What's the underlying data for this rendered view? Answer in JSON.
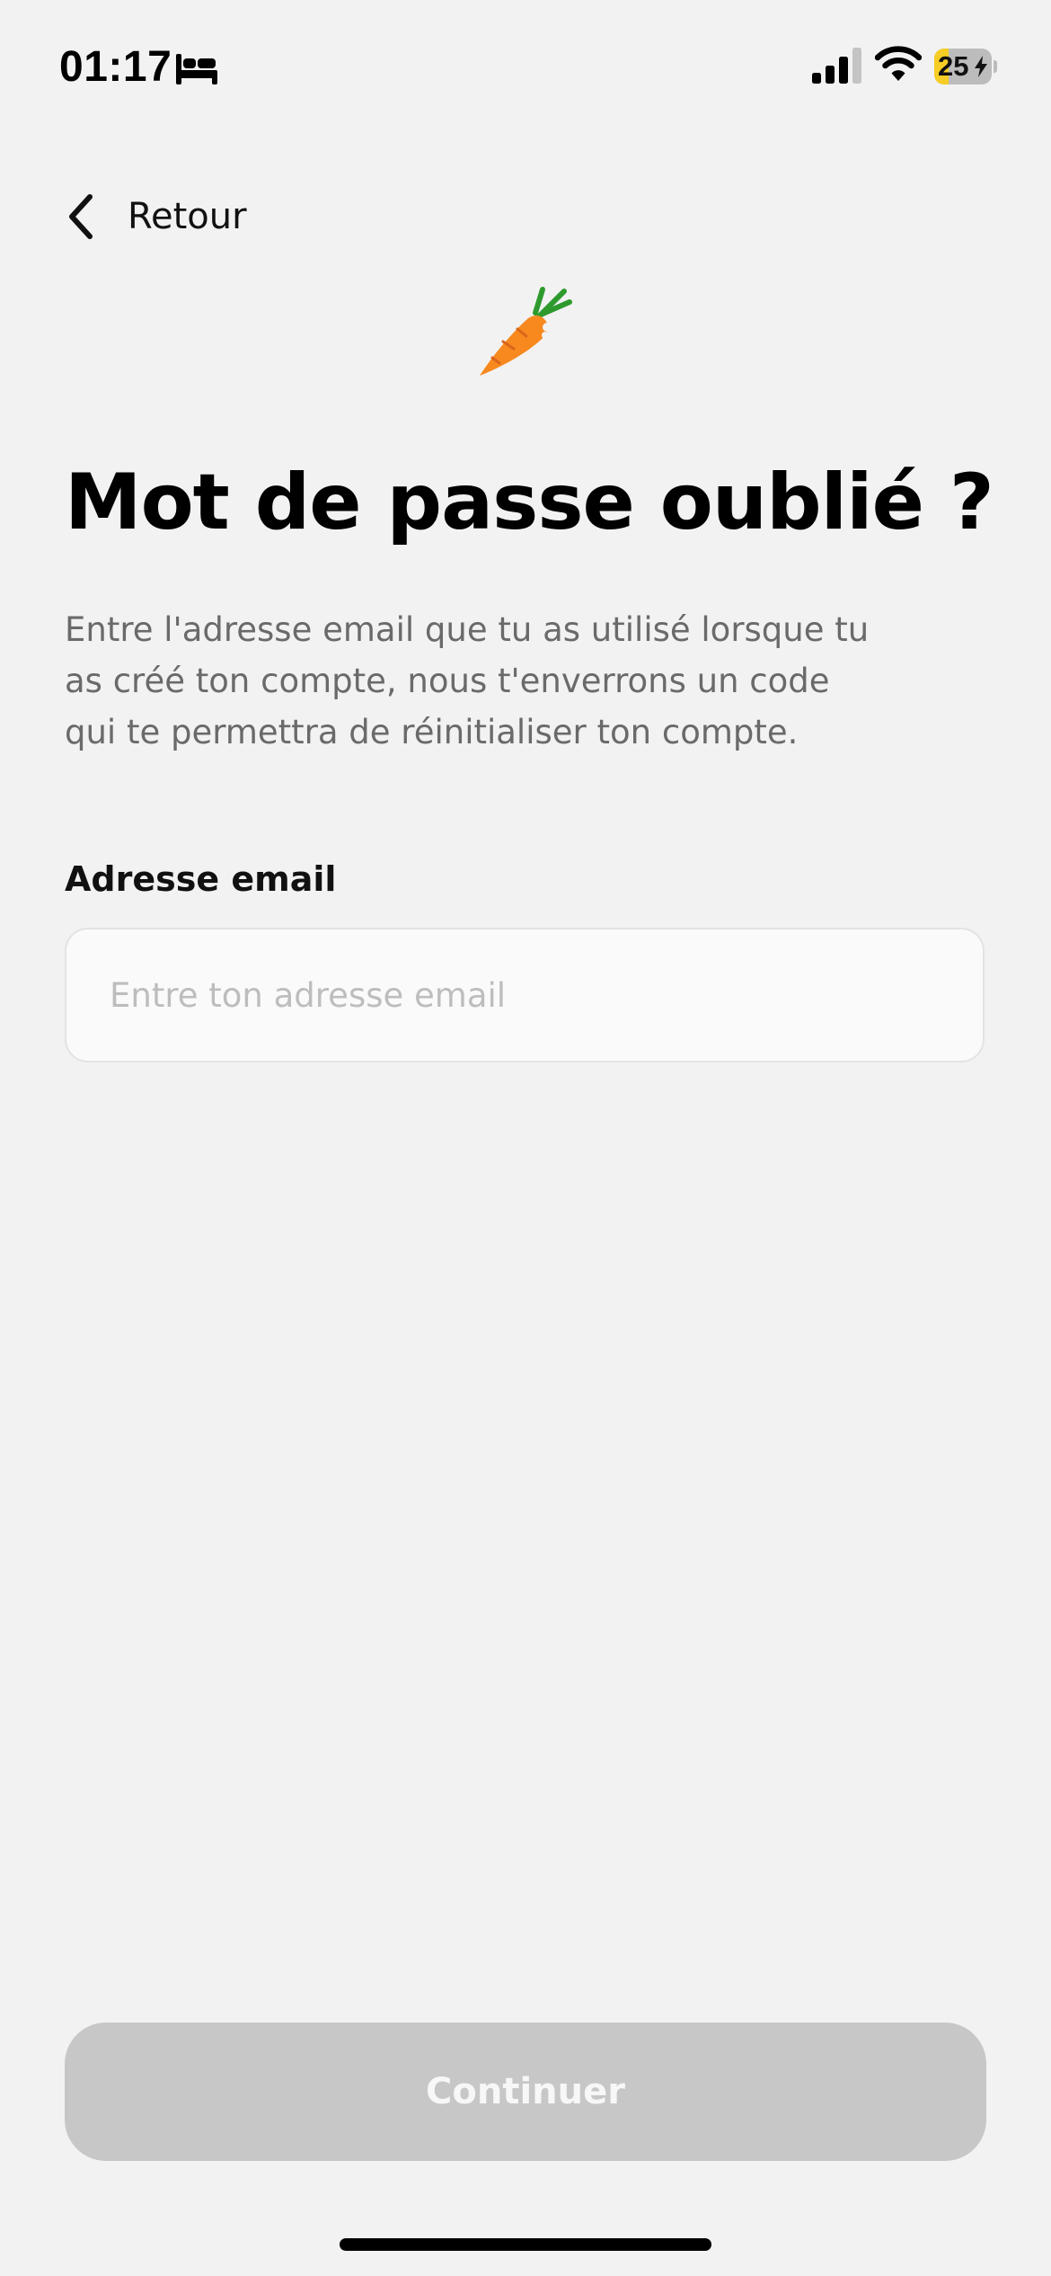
{
  "status_bar": {
    "time": "01:17",
    "battery_level": "25",
    "battery_fraction": 0.25,
    "battery_color": "#f6cd24",
    "icons": [
      "bed-icon",
      "signal-icon",
      "wifi-icon",
      "battery-icon",
      "bolt-icon"
    ]
  },
  "nav": {
    "back_label": "Retour",
    "back_icon": "chevron-left-icon"
  },
  "illustration": {
    "icon": "carrot-icon"
  },
  "page": {
    "title": "Mot de passe oublié ?",
    "description": "Entre l'adresse email que tu as utilisé lorsque tu as créé ton compte, nous t'enverrons un code qui te permettra de réinitialiser ton compte."
  },
  "form": {
    "email_label": "Adresse email",
    "email_value": "",
    "email_placeholder": "Entre ton adresse email"
  },
  "actions": {
    "continue_label": "Continuer",
    "continue_disabled": true
  },
  "colors": {
    "background": "#f2f2f2",
    "button_disabled": "#c7c7c7",
    "carrot_orange": "#f7891f",
    "carrot_leaf": "#2e9a2e"
  }
}
